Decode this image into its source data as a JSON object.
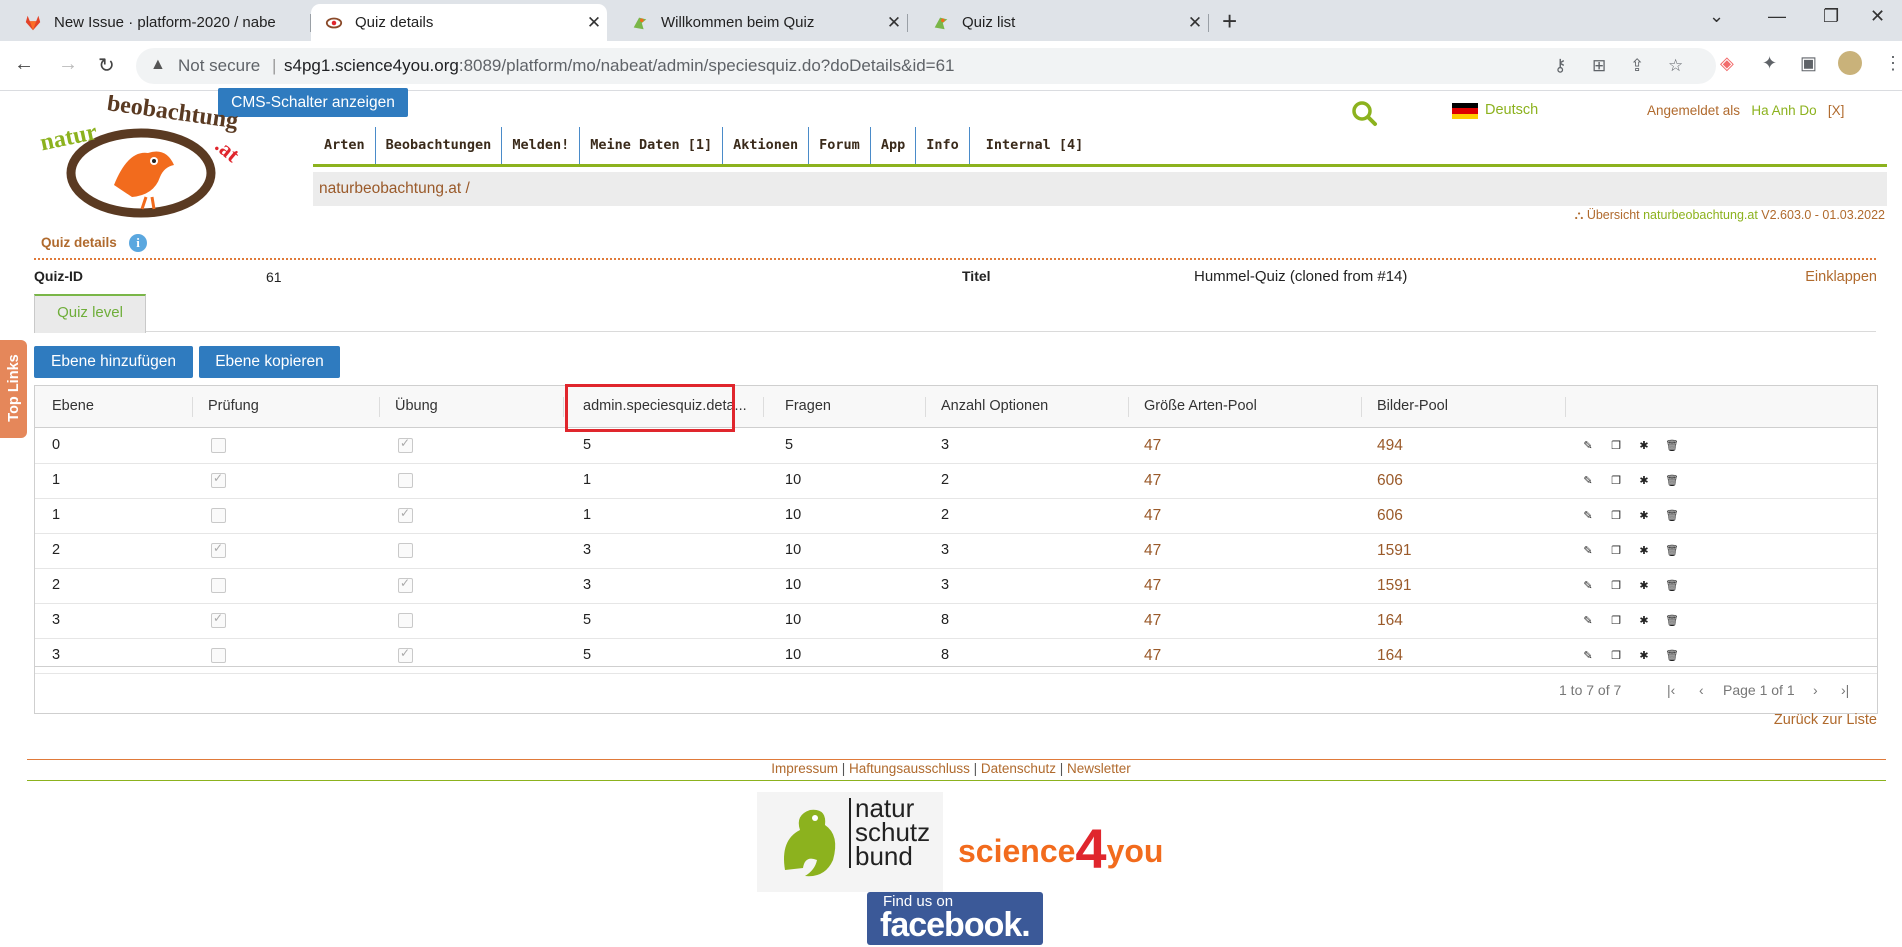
{
  "browser": {
    "tabs": [
      {
        "title": "New Issue · platform-2020 / nabe",
        "favicon": "gitlab-icon"
      },
      {
        "title": "Quiz details",
        "favicon": "eye-icon",
        "active": true
      },
      {
        "title": "Willkommen beim Quiz",
        "favicon": "bird-icon"
      },
      {
        "title": "Quiz list",
        "favicon": "bird-icon"
      }
    ],
    "security": "Not secure",
    "url_host": "s4pg1.science4you.org",
    "url_rest": ":8089/platform/mo/nabeat/admin/speciesquiz.do?doDetails&id=61"
  },
  "header": {
    "cms_button": "CMS-Schalter anzeigen",
    "language": "Deutsch",
    "logged_in_as": "Angemeldet als",
    "user": "Ha Anh Do",
    "logout": "[X]",
    "logo_text": "naturbeobachtung.at",
    "nav": [
      "Arten",
      "Beobachtungen",
      "Melden!",
      "Meine Daten [1]",
      "Aktionen",
      "Forum",
      "App",
      "Info",
      "Internal [4]"
    ],
    "breadcrumb": "naturbeobachtung.at /",
    "overview": "Übersicht",
    "version_site": "naturbeobachtung.at",
    "version": "V2.603.0 - 01.03.2022"
  },
  "quiz": {
    "section_title": "Quiz details",
    "id_label": "Quiz-ID",
    "id_value": "61",
    "title_label": "Titel",
    "title_value": "Hummel-Quiz (cloned from #14)",
    "collapse": "Einklappen",
    "tab": "Quiz level",
    "add_button": "Ebene hinzufügen",
    "copy_button": "Ebene kopieren"
  },
  "grid": {
    "columns": [
      "Ebene",
      "Prüfung",
      "Übung",
      "admin.speciesquiz.deta...",
      "Fragen",
      "Anzahl Optionen",
      "Größe Arten-Pool",
      "Bilder-Pool"
    ],
    "rows": [
      {
        "ebene": "0",
        "pruefung": false,
        "uebung": true,
        "detail": "5",
        "fragen": "5",
        "optionen": "3",
        "arten": "47",
        "bilder": "494"
      },
      {
        "ebene": "1",
        "pruefung": true,
        "uebung": false,
        "detail": "1",
        "fragen": "10",
        "optionen": "2",
        "arten": "47",
        "bilder": "606"
      },
      {
        "ebene": "1",
        "pruefung": false,
        "uebung": true,
        "detail": "1",
        "fragen": "10",
        "optionen": "2",
        "arten": "47",
        "bilder": "606"
      },
      {
        "ebene": "2",
        "pruefung": true,
        "uebung": false,
        "detail": "3",
        "fragen": "10",
        "optionen": "3",
        "arten": "47",
        "bilder": "1591"
      },
      {
        "ebene": "2",
        "pruefung": false,
        "uebung": true,
        "detail": "3",
        "fragen": "10",
        "optionen": "3",
        "arten": "47",
        "bilder": "1591"
      },
      {
        "ebene": "3",
        "pruefung": true,
        "uebung": false,
        "detail": "5",
        "fragen": "10",
        "optionen": "8",
        "arten": "47",
        "bilder": "164"
      },
      {
        "ebene": "3",
        "pruefung": false,
        "uebung": true,
        "detail": "5",
        "fragen": "10",
        "optionen": "8",
        "arten": "47",
        "bilder": "164"
      }
    ],
    "row_actions": [
      "edit-icon",
      "copy-icon",
      "bug-icon",
      "trash-icon"
    ],
    "range": "1 to 7 of 7",
    "page": "Page 1 of 1"
  },
  "back_link": "Zurück zur Liste",
  "footer": {
    "links": [
      "Impressum",
      "Haftungsausschluss",
      "Datenschutz",
      "Newsletter"
    ],
    "nsb_logo": [
      "natur",
      "schutz",
      "bund"
    ],
    "s4y_logo": [
      "science",
      "4",
      "you"
    ],
    "facebook_small": "Find us on",
    "facebook_big": "facebook."
  },
  "side_tab": "Top Links",
  "colors": {
    "accent_green": "#8cb21e",
    "accent_brown": "#b06a2d",
    "button_blue": "#2f7bbf",
    "highlight_red": "#e0262d"
  }
}
